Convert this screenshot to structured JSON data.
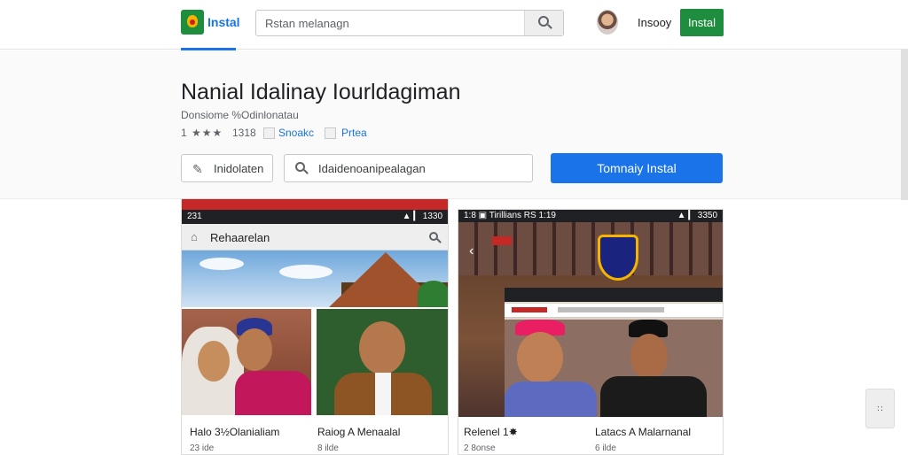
{
  "header": {
    "logo_text": "Instal",
    "search_placeholder": "Rstan melanagn",
    "user_name": "Insooy",
    "install_label": "Instal"
  },
  "app": {
    "title": "Nanial Idalinay Iourldagiman",
    "developer": "Donsiome %Odinlonatau",
    "rating_value": "1",
    "rating_stars": "★★★",
    "rating_count": "1318",
    "tag1": "Snoakc",
    "tag2": "Prtea",
    "wishlist_label": "Inidolaten",
    "search2_label": "Idaidenoanipealagan",
    "install_button": "Tomnaiy Instal"
  },
  "screenshots": [
    {
      "status_time": "231",
      "status_right": "▲ ▎ 1330",
      "appbar_label": "Rehaarelan",
      "items": [
        {
          "caption": "Halo 3½Olanialiam",
          "sub": "23 ide"
        },
        {
          "caption": "Raiog A Menaalal",
          "sub": "8 ilde"
        }
      ]
    },
    {
      "status_time": "1:8 ▣ Tirillians RS 1:19",
      "status_right": "▲ ▎ 3350",
      "items": [
        {
          "caption": "Relenel 1✸",
          "sub": "2 8onse"
        },
        {
          "caption": "Latacs A Malarnanal",
          "sub": "6 ilde"
        }
      ]
    }
  ],
  "side_button_label": "∷",
  "colors": {
    "accent_blue": "#1a73e8",
    "brand_green": "#1e8e3e",
    "phone_top_red": "#c62828"
  }
}
